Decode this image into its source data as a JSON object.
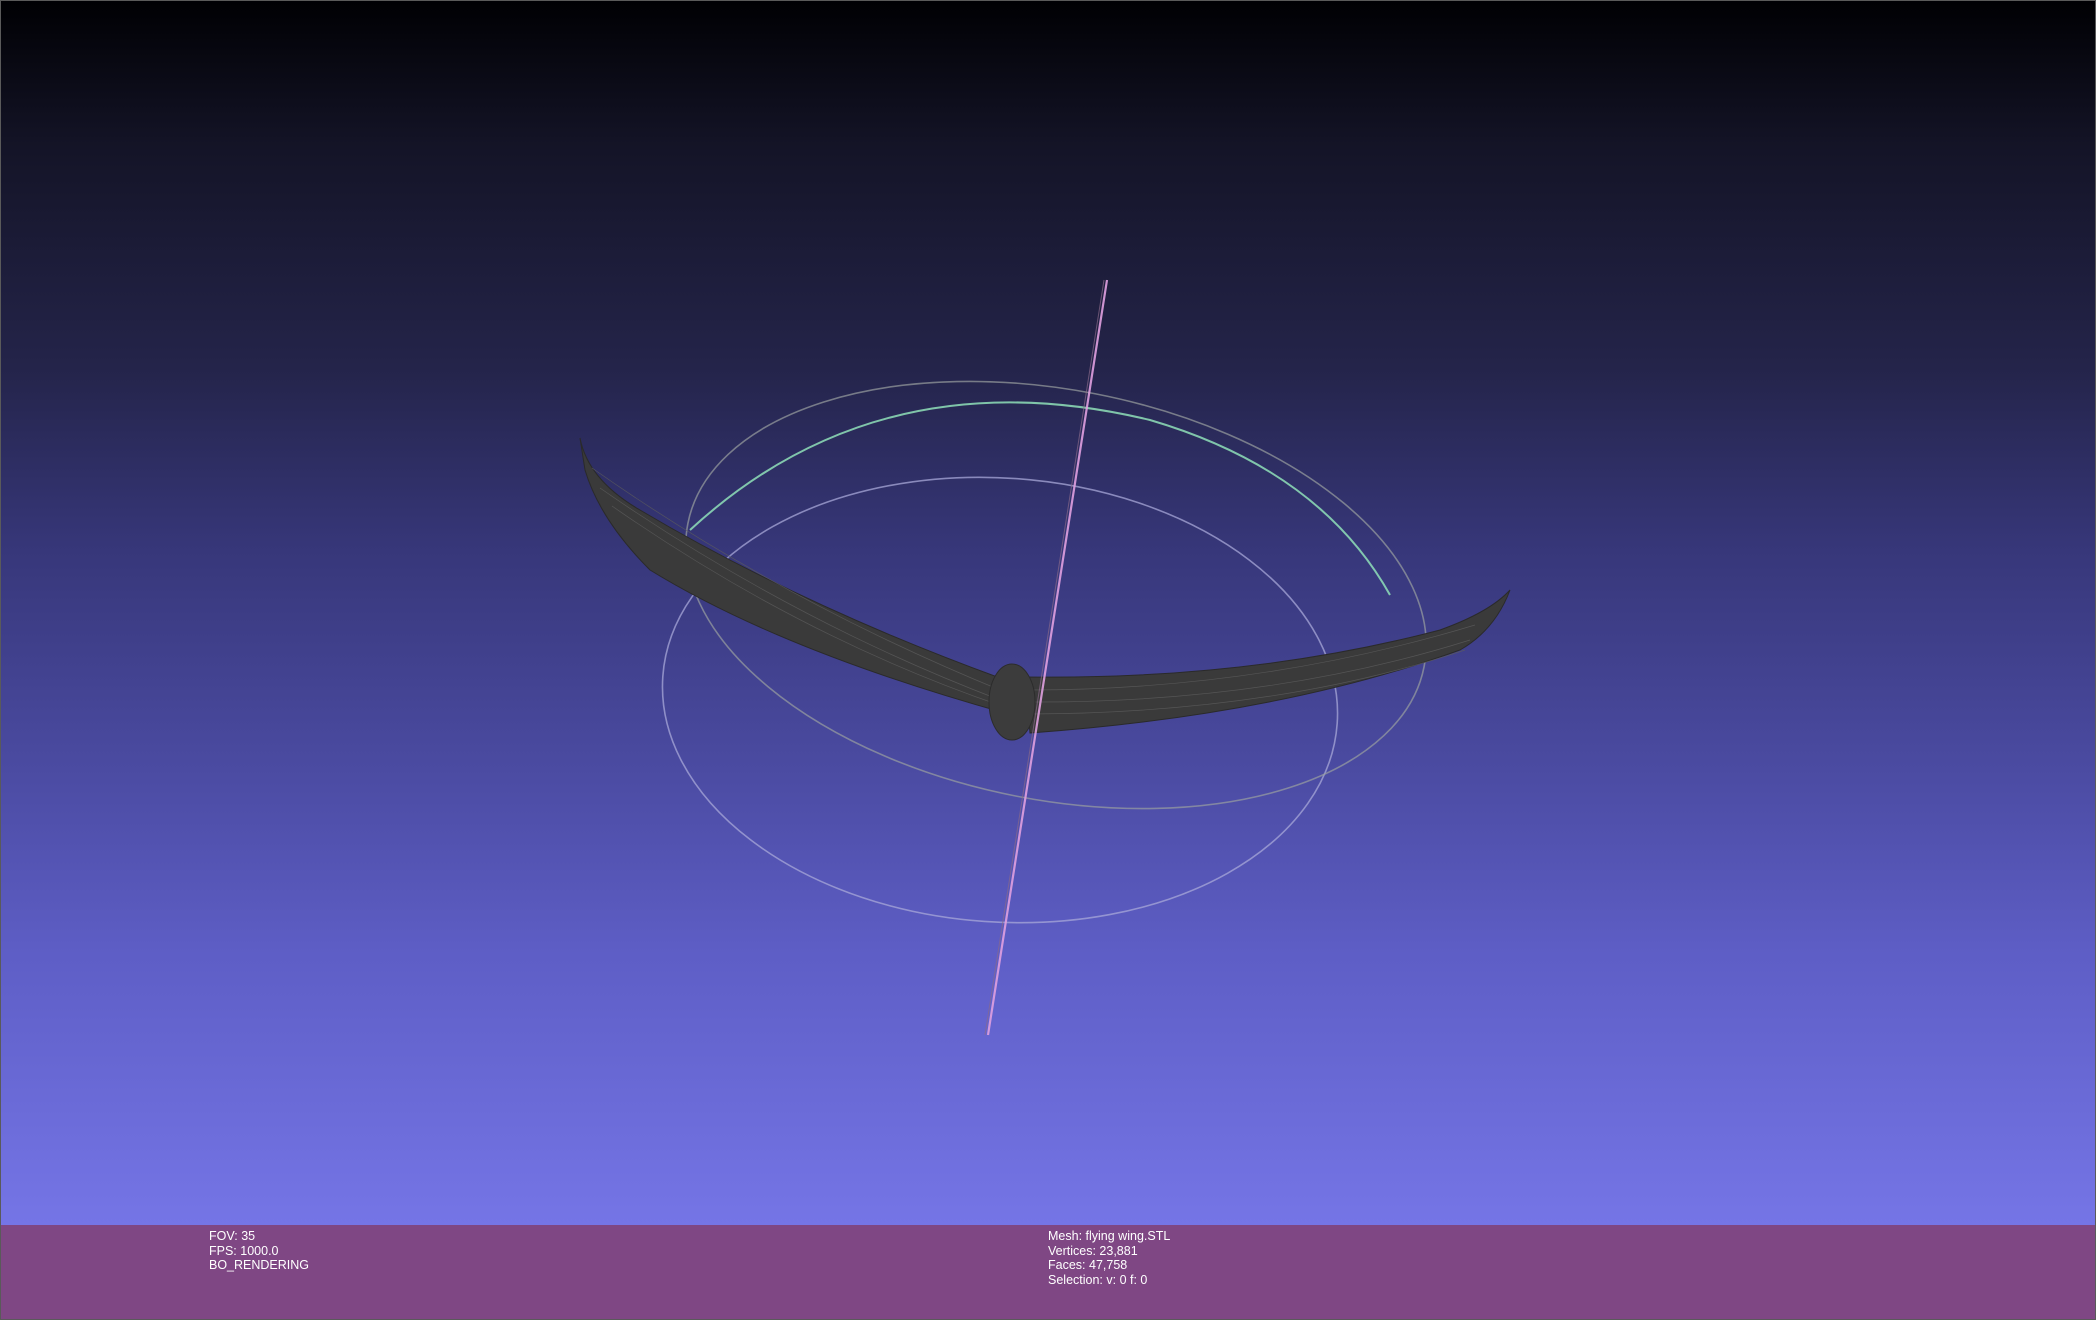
{
  "view": {
    "fov_label": "FOV:",
    "fov_value": "35",
    "fps_label": "FPS:",
    "fps_value": "1000.0",
    "render_mode": "BO_RENDERING"
  },
  "mesh": {
    "name_label": "Mesh:",
    "name": "flying wing.STL",
    "vertices_label": "Vertices:",
    "vertices": "23,881",
    "faces_label": "Faces:",
    "faces": "47,758",
    "selection_label": "Selection:",
    "selection": "v: 0 f: 0"
  },
  "colors": {
    "statusbar": "#7f4784",
    "mesh": "#3a3a3a",
    "trackball_x": "#e0a0e0",
    "trackball_y": "#8fe0b8",
    "trackball_z": "#b8b8e6"
  },
  "icons": {
    "trackball": "trackball-gizmo",
    "model": "flying-wing-mesh"
  }
}
